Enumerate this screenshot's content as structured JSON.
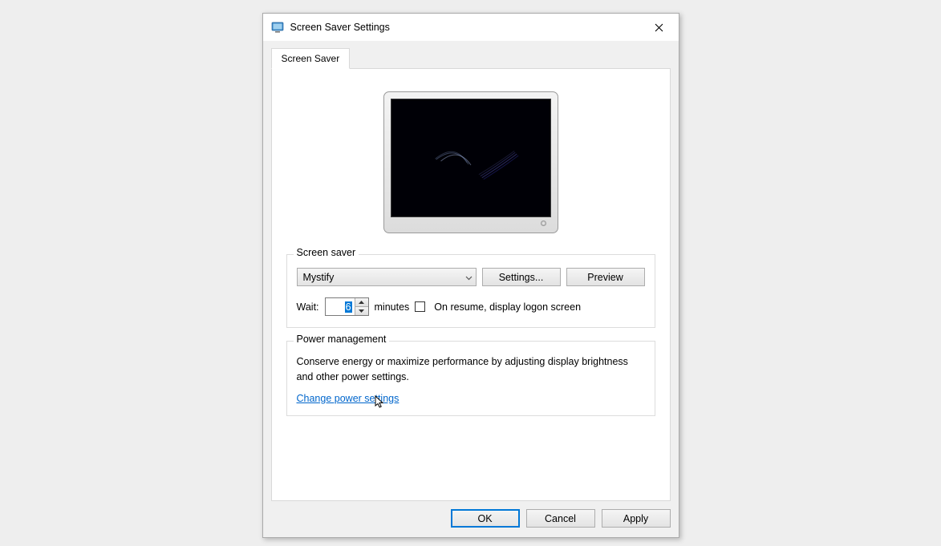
{
  "window": {
    "title": "Screen Saver Settings"
  },
  "tab": {
    "label": "Screen Saver"
  },
  "screensaver_group": {
    "legend": "Screen saver",
    "selected": "Mystify",
    "settings_btn": "Settings...",
    "preview_btn": "Preview",
    "wait_label": "Wait:",
    "wait_value": "6",
    "minutes_label": "minutes",
    "resume_label": "On resume, display logon screen"
  },
  "power_group": {
    "legend": "Power management",
    "description": "Conserve energy or maximize performance by adjusting display brightness and other power settings.",
    "link": "Change power settings"
  },
  "buttons": {
    "ok": "OK",
    "cancel": "Cancel",
    "apply": "Apply"
  }
}
